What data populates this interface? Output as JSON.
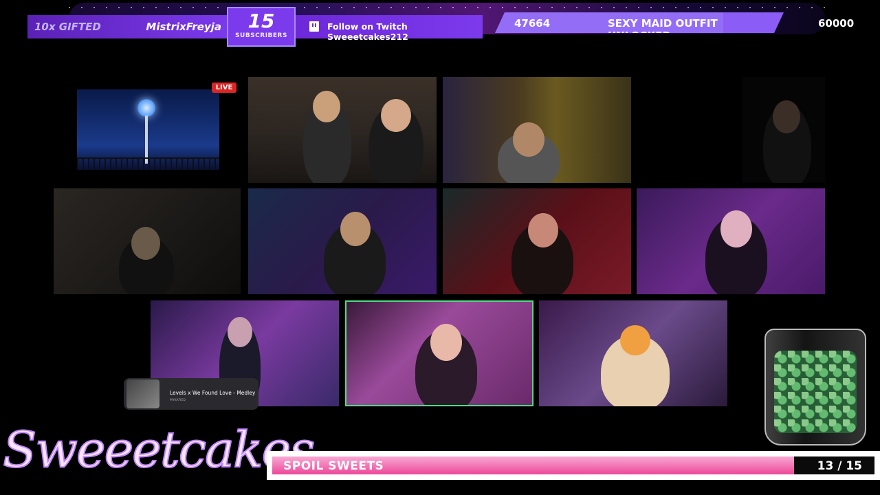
{
  "alert_bar": {
    "gifted_label": "10x GIFTED",
    "gifter_name": "MistrixFreyja",
    "subscriber_count": "15",
    "subscriber_label": "SUBSCRIBERS",
    "follow_text": "Follow on Twitch Sweeetcakes212"
  },
  "goal": {
    "current": "47664",
    "title": "SEXY MAID OUTFIT UNLOCKED",
    "target": "60000",
    "progress_fraction": 0.79
  },
  "live_badge": "LIVE",
  "now_playing": {
    "title": "Levels x We Found Love - Medley",
    "artist": "MYKAFIED"
  },
  "tip_jar": {
    "icon": "k-coins-jar"
  },
  "brand": {
    "logo_text": "Sweeetcakes"
  },
  "spoil_goal": {
    "label": "SPOIL SWEETS",
    "count": "13 / 15",
    "progress_fraction": 0.867
  },
  "colors": {
    "accent_purple": "#7c3aed",
    "progress_pink": "#ec4899",
    "live_red": "#dc2626",
    "active_speaker_green": "#4ade80"
  }
}
